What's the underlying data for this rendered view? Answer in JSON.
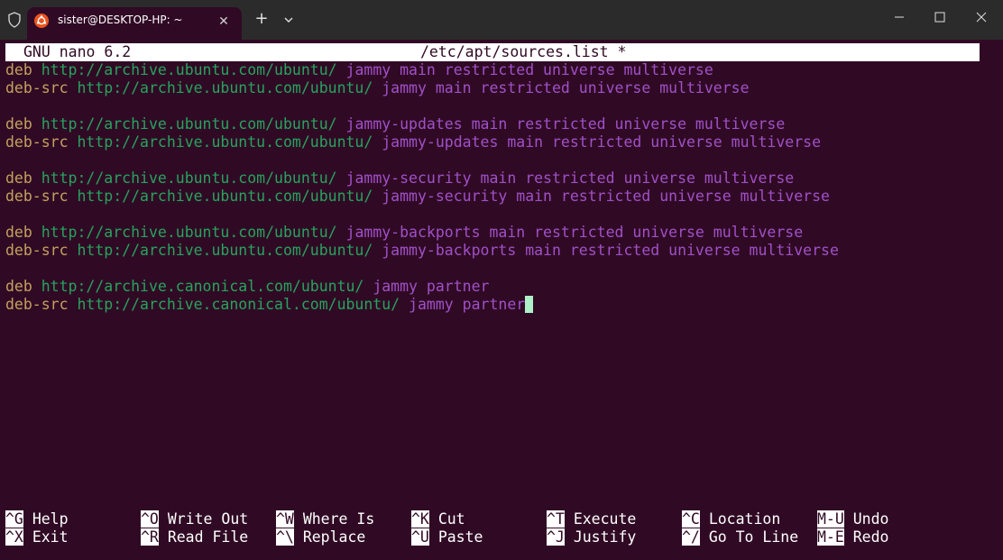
{
  "window": {
    "tab_title": "sister@DESKTOP-HP: ~",
    "tab_close_glyph": "✕",
    "new_tab_glyph": "+",
    "icons": [
      "shield-icon",
      "ubuntu-icon",
      "close-icon",
      "plus-icon",
      "chevron-down-icon",
      "minimize-icon",
      "maximize-icon",
      "close-window-icon"
    ]
  },
  "nano": {
    "version": "GNU nano 6.2",
    "filename": "/etc/apt/sources.list *"
  },
  "lines": [
    {
      "type": "deb",
      "url": "http://archive.ubuntu.com/ubuntu/",
      "components": "jammy main restricted universe multiverse"
    },
    {
      "type": "deb-src",
      "url": "http://archive.ubuntu.com/ubuntu/",
      "components": "jammy main restricted universe multiverse"
    },
    {
      "type": "",
      "url": "",
      "components": ""
    },
    {
      "type": "deb",
      "url": "http://archive.ubuntu.com/ubuntu/",
      "components": "jammy-updates main restricted universe multiverse"
    },
    {
      "type": "deb-src",
      "url": "http://archive.ubuntu.com/ubuntu/",
      "components": "jammy-updates main restricted universe multiverse"
    },
    {
      "type": "",
      "url": "",
      "components": ""
    },
    {
      "type": "deb",
      "url": "http://archive.ubuntu.com/ubuntu/",
      "components": "jammy-security main restricted universe multiverse"
    },
    {
      "type": "deb-src",
      "url": "http://archive.ubuntu.com/ubuntu/",
      "components": "jammy-security main restricted universe multiverse"
    },
    {
      "type": "",
      "url": "",
      "components": ""
    },
    {
      "type": "deb",
      "url": "http://archive.ubuntu.com/ubuntu/",
      "components": "jammy-backports main restricted universe multiverse"
    },
    {
      "type": "deb-src",
      "url": "http://archive.ubuntu.com/ubuntu/",
      "components": "jammy-backports main restricted universe multiverse"
    },
    {
      "type": "",
      "url": "",
      "components": ""
    },
    {
      "type": "deb",
      "url": "http://archive.canonical.com/ubuntu/",
      "components": "jammy partner"
    },
    {
      "type": "deb-src",
      "url": "http://archive.canonical.com/ubuntu/",
      "components": "jammy partner"
    }
  ],
  "shortcuts": [
    {
      "key": "^G",
      "label": "Help"
    },
    {
      "key": "^X",
      "label": "Exit"
    },
    {
      "key": "^O",
      "label": "Write Out"
    },
    {
      "key": "^R",
      "label": "Read File"
    },
    {
      "key": "^W",
      "label": "Where Is"
    },
    {
      "key": "^\\",
      "label": "Replace"
    },
    {
      "key": "^K",
      "label": "Cut"
    },
    {
      "key": "^U",
      "label": "Paste"
    },
    {
      "key": "^T",
      "label": "Execute"
    },
    {
      "key": "^J",
      "label": "Justify"
    },
    {
      "key": "^C",
      "label": "Location"
    },
    {
      "key": "^/",
      "label": "Go To Line"
    },
    {
      "key": "M-U",
      "label": "Undo"
    },
    {
      "key": "M-E",
      "label": "Redo"
    }
  ],
  "colors": {
    "background": "#300a24",
    "titlebar": "#2b2b2b",
    "type": "#c4a060",
    "url": "#27a35f",
    "components": "#a050c8",
    "cursor": "#aef0c8"
  }
}
